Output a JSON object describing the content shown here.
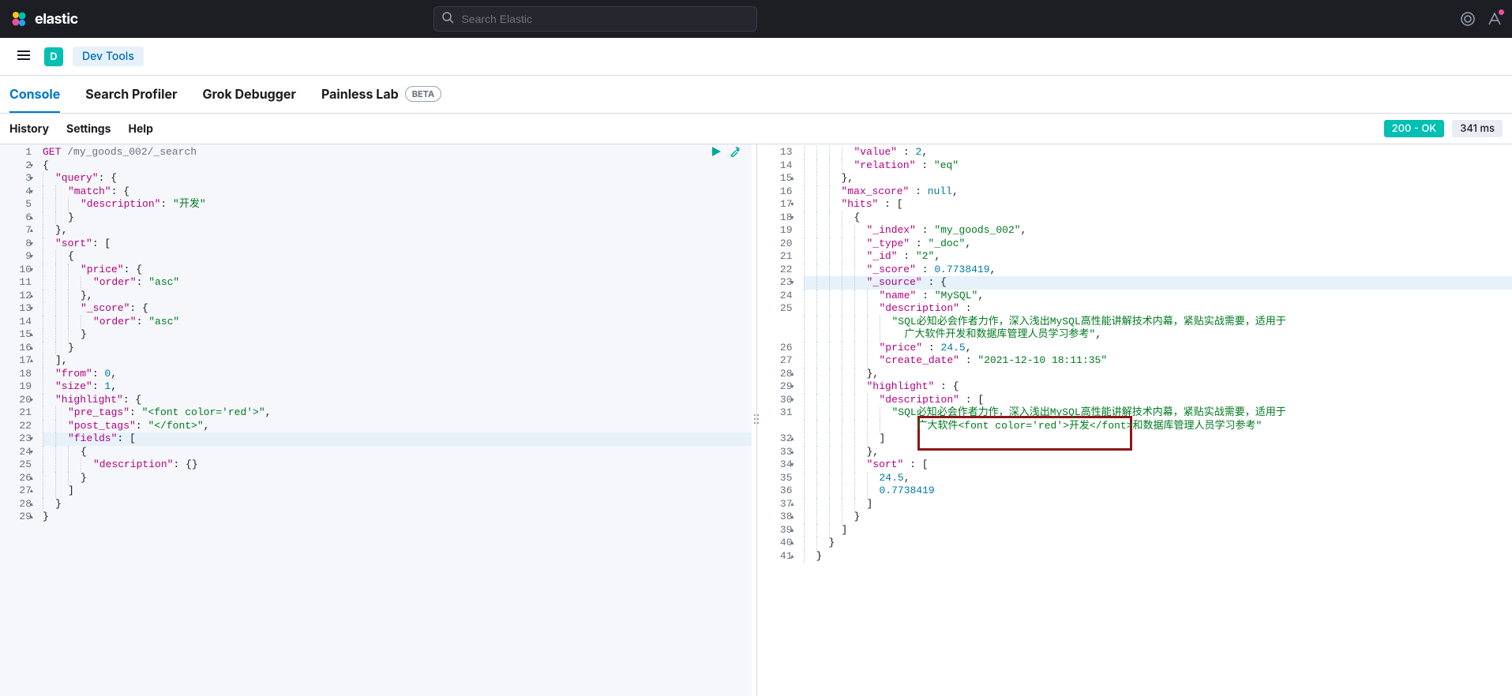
{
  "header": {
    "brand": "elastic",
    "search_placeholder": "Search Elastic"
  },
  "sub_header": {
    "app_badge": "D",
    "app_pill": "Dev Tools"
  },
  "tabs": [
    {
      "label": "Console",
      "active": true
    },
    {
      "label": "Search Profiler",
      "active": false
    },
    {
      "label": "Grok Debugger",
      "active": false
    },
    {
      "label": "Painless Lab",
      "active": false,
      "badge": "BETA"
    }
  ],
  "toolbar": {
    "items": [
      "History",
      "Settings",
      "Help"
    ],
    "status": "200 - OK",
    "timing": "341 ms"
  },
  "request": {
    "method": "GET",
    "path": "/my_goods_002/_search",
    "lines": [
      {
        "n": 1,
        "fold": "",
        "t": [
          {
            "c": "t-method",
            "v": "GET "
          },
          {
            "c": "t-path",
            "v": "/my_goods_002/_search"
          }
        ]
      },
      {
        "n": 2,
        "fold": "▾",
        "t": [
          {
            "c": "t-punc",
            "v": "{"
          }
        ]
      },
      {
        "n": 3,
        "fold": "▾",
        "i": 1,
        "t": [
          {
            "c": "t-key",
            "v": "\"query\""
          },
          {
            "c": "t-punc",
            "v": ": {"
          }
        ]
      },
      {
        "n": 4,
        "fold": "▾",
        "i": 2,
        "t": [
          {
            "c": "t-key",
            "v": "\"match\""
          },
          {
            "c": "t-punc",
            "v": ": {"
          }
        ]
      },
      {
        "n": 5,
        "i": 3,
        "t": [
          {
            "c": "t-key",
            "v": "\"description\""
          },
          {
            "c": "t-punc",
            "v": ": "
          },
          {
            "c": "t-str",
            "v": "\"开发\""
          }
        ]
      },
      {
        "n": 6,
        "fold": "▴",
        "i": 2,
        "t": [
          {
            "c": "t-punc",
            "v": "}"
          }
        ]
      },
      {
        "n": 7,
        "fold": "▴",
        "i": 1,
        "t": [
          {
            "c": "t-punc",
            "v": "},"
          }
        ]
      },
      {
        "n": 8,
        "fold": "▾",
        "i": 1,
        "t": [
          {
            "c": "t-key",
            "v": "\"sort\""
          },
          {
            "c": "t-punc",
            "v": ": ["
          }
        ]
      },
      {
        "n": 9,
        "fold": "▾",
        "i": 2,
        "t": [
          {
            "c": "t-punc",
            "v": "{"
          }
        ]
      },
      {
        "n": 10,
        "fold": "▾",
        "i": 3,
        "t": [
          {
            "c": "t-key",
            "v": "\"price\""
          },
          {
            "c": "t-punc",
            "v": ": {"
          }
        ]
      },
      {
        "n": 11,
        "i": 4,
        "t": [
          {
            "c": "t-key",
            "v": "\"order\""
          },
          {
            "c": "t-punc",
            "v": ": "
          },
          {
            "c": "t-str",
            "v": "\"asc\""
          }
        ]
      },
      {
        "n": 12,
        "fold": "▴",
        "i": 3,
        "t": [
          {
            "c": "t-punc",
            "v": "},"
          }
        ]
      },
      {
        "n": 13,
        "fold": "▾",
        "i": 3,
        "t": [
          {
            "c": "t-key",
            "v": "\"_score\""
          },
          {
            "c": "t-punc",
            "v": ": {"
          }
        ]
      },
      {
        "n": 14,
        "i": 4,
        "t": [
          {
            "c": "t-key",
            "v": "\"order\""
          },
          {
            "c": "t-punc",
            "v": ": "
          },
          {
            "c": "t-str",
            "v": "\"asc\""
          }
        ]
      },
      {
        "n": 15,
        "fold": "▴",
        "i": 3,
        "t": [
          {
            "c": "t-punc",
            "v": "}"
          }
        ]
      },
      {
        "n": 16,
        "fold": "▴",
        "i": 2,
        "t": [
          {
            "c": "t-punc",
            "v": "}"
          }
        ]
      },
      {
        "n": 17,
        "fold": "▴",
        "i": 1,
        "t": [
          {
            "c": "t-punc",
            "v": "],"
          }
        ]
      },
      {
        "n": 18,
        "i": 1,
        "t": [
          {
            "c": "t-key",
            "v": "\"from\""
          },
          {
            "c": "t-punc",
            "v": ": "
          },
          {
            "c": "t-num",
            "v": "0"
          },
          {
            "c": "t-punc",
            "v": ","
          }
        ]
      },
      {
        "n": 19,
        "i": 1,
        "t": [
          {
            "c": "t-key",
            "v": "\"size\""
          },
          {
            "c": "t-punc",
            "v": ": "
          },
          {
            "c": "t-num",
            "v": "1"
          },
          {
            "c": "t-punc",
            "v": ","
          }
        ]
      },
      {
        "n": 20,
        "fold": "▾",
        "i": 1,
        "t": [
          {
            "c": "t-key",
            "v": "\"highlight\""
          },
          {
            "c": "t-punc",
            "v": ": {"
          }
        ]
      },
      {
        "n": 21,
        "i": 2,
        "t": [
          {
            "c": "t-key",
            "v": "\"pre_tags\""
          },
          {
            "c": "t-punc",
            "v": ": "
          },
          {
            "c": "t-str",
            "v": "\"<font color='red'>\""
          },
          {
            "c": "t-punc",
            "v": ","
          }
        ]
      },
      {
        "n": 22,
        "i": 2,
        "t": [
          {
            "c": "t-key",
            "v": "\"post_tags\""
          },
          {
            "c": "t-punc",
            "v": ": "
          },
          {
            "c": "t-str",
            "v": "\"</font>\""
          },
          {
            "c": "t-punc",
            "v": ","
          }
        ]
      },
      {
        "n": 23,
        "fold": "▾",
        "i": 2,
        "hl": true,
        "t": [
          {
            "c": "t-key",
            "v": "\"fields\""
          },
          {
            "c": "t-punc",
            "v": ": ["
          }
        ]
      },
      {
        "n": 24,
        "fold": "▾",
        "i": 3,
        "t": [
          {
            "c": "t-punc",
            "v": "{"
          }
        ]
      },
      {
        "n": 25,
        "i": 4,
        "t": [
          {
            "c": "t-key",
            "v": "\"description\""
          },
          {
            "c": "t-punc",
            "v": ": {}"
          }
        ]
      },
      {
        "n": 26,
        "fold": "▴",
        "i": 3,
        "t": [
          {
            "c": "t-punc",
            "v": "}"
          }
        ]
      },
      {
        "n": 27,
        "fold": "▴",
        "i": 2,
        "t": [
          {
            "c": "t-punc",
            "v": "]"
          }
        ]
      },
      {
        "n": 28,
        "fold": "▴",
        "i": 1,
        "t": [
          {
            "c": "t-punc",
            "v": "}"
          }
        ]
      },
      {
        "n": 29,
        "fold": "▴",
        "t": [
          {
            "c": "t-punc",
            "v": "}"
          }
        ]
      }
    ]
  },
  "response": {
    "lines": [
      {
        "n": 13,
        "i": 4,
        "t": [
          {
            "c": "t-key",
            "v": "\"value\""
          },
          {
            "c": "t-punc",
            "v": " : "
          },
          {
            "c": "t-num",
            "v": "2"
          },
          {
            "c": "t-punc",
            "v": ","
          }
        ]
      },
      {
        "n": 14,
        "i": 4,
        "t": [
          {
            "c": "t-key",
            "v": "\"relation\""
          },
          {
            "c": "t-punc",
            "v": " : "
          },
          {
            "c": "t-str",
            "v": "\"eq\""
          }
        ]
      },
      {
        "n": 15,
        "fold": "▴",
        "i": 3,
        "t": [
          {
            "c": "t-punc",
            "v": "},"
          }
        ]
      },
      {
        "n": 16,
        "i": 3,
        "t": [
          {
            "c": "t-key",
            "v": "\"max_score\""
          },
          {
            "c": "t-punc",
            "v": " : "
          },
          {
            "c": "t-kw",
            "v": "null"
          },
          {
            "c": "t-punc",
            "v": ","
          }
        ]
      },
      {
        "n": 17,
        "fold": "▾",
        "i": 3,
        "t": [
          {
            "c": "t-key",
            "v": "\"hits\""
          },
          {
            "c": "t-punc",
            "v": " : ["
          }
        ]
      },
      {
        "n": 18,
        "fold": "▾",
        "i": 4,
        "t": [
          {
            "c": "t-punc",
            "v": "{"
          }
        ]
      },
      {
        "n": 19,
        "i": 5,
        "t": [
          {
            "c": "t-key",
            "v": "\"_index\""
          },
          {
            "c": "t-punc",
            "v": " : "
          },
          {
            "c": "t-str",
            "v": "\"my_goods_002\""
          },
          {
            "c": "t-punc",
            "v": ","
          }
        ]
      },
      {
        "n": 20,
        "i": 5,
        "t": [
          {
            "c": "t-key",
            "v": "\"_type\""
          },
          {
            "c": "t-punc",
            "v": " : "
          },
          {
            "c": "t-str",
            "v": "\"_doc\""
          },
          {
            "c": "t-punc",
            "v": ","
          }
        ]
      },
      {
        "n": 21,
        "i": 5,
        "t": [
          {
            "c": "t-key",
            "v": "\"_id\""
          },
          {
            "c": "t-punc",
            "v": " : "
          },
          {
            "c": "t-str",
            "v": "\"2\""
          },
          {
            "c": "t-punc",
            "v": ","
          }
        ]
      },
      {
        "n": 22,
        "i": 5,
        "t": [
          {
            "c": "t-key",
            "v": "\"_score\""
          },
          {
            "c": "t-punc",
            "v": " : "
          },
          {
            "c": "t-num",
            "v": "0.7738419"
          },
          {
            "c": "t-punc",
            "v": ","
          }
        ]
      },
      {
        "n": 23,
        "fold": "▾",
        "i": 5,
        "hl": true,
        "t": [
          {
            "c": "t-key",
            "v": "\"_source\""
          },
          {
            "c": "t-punc",
            "v": " : {"
          }
        ]
      },
      {
        "n": 24,
        "i": 6,
        "t": [
          {
            "c": "t-key",
            "v": "\"name\""
          },
          {
            "c": "t-punc",
            "v": " : "
          },
          {
            "c": "t-str",
            "v": "\"MySQL\""
          },
          {
            "c": "t-punc",
            "v": ","
          }
        ]
      },
      {
        "n": 25,
        "i": 6,
        "t": [
          {
            "c": "t-key",
            "v": "\"description\""
          },
          {
            "c": "t-punc",
            "v": " :"
          }
        ]
      },
      {
        "n": "25b",
        "i": 7,
        "t": [
          {
            "c": "t-str",
            "v": "\"SQL必知必会作者力作，深入浅出MySQL高性能讲解技术内幕，紧贴实战需要，适用于"
          }
        ]
      },
      {
        "n": "25c",
        "i": 7,
        "ex": 1,
        "t": [
          {
            "c": "t-str",
            "v": "广大软件开发和数据库管理人员学习参考\""
          },
          {
            "c": "t-punc",
            "v": ","
          }
        ]
      },
      {
        "n": 26,
        "i": 6,
        "t": [
          {
            "c": "t-key",
            "v": "\"price\""
          },
          {
            "c": "t-punc",
            "v": " : "
          },
          {
            "c": "t-num",
            "v": "24.5"
          },
          {
            "c": "t-punc",
            "v": ","
          }
        ]
      },
      {
        "n": 27,
        "i": 6,
        "t": [
          {
            "c": "t-key",
            "v": "\"create_date\""
          },
          {
            "c": "t-punc",
            "v": " : "
          },
          {
            "c": "t-str",
            "v": "\"2021-12-10 18:11:35\""
          }
        ]
      },
      {
        "n": 28,
        "fold": "▴",
        "i": 5,
        "t": [
          {
            "c": "t-punc",
            "v": "},"
          }
        ]
      },
      {
        "n": 29,
        "fold": "▾",
        "i": 5,
        "t": [
          {
            "c": "t-key",
            "v": "\"highlight\""
          },
          {
            "c": "t-punc",
            "v": " : {"
          }
        ]
      },
      {
        "n": 30,
        "fold": "▾",
        "i": 6,
        "t": [
          {
            "c": "t-key",
            "v": "\"description\""
          },
          {
            "c": "t-punc",
            "v": " : ["
          }
        ]
      },
      {
        "n": 31,
        "i": 7,
        "t": [
          {
            "c": "t-str",
            "v": "\"SQL必知必会作者力作，深入浅出MySQL高性能讲解技术内幕，紧贴实战需要，适用于"
          }
        ]
      },
      {
        "n": "31b",
        "i": 7,
        "ex": 2,
        "t": [
          {
            "c": "t-str",
            "v": "广大软件<font color='red'>开发</font>和数据库管理人员学习参考\""
          }
        ]
      },
      {
        "n": 32,
        "fold": "▴",
        "i": 6,
        "t": [
          {
            "c": "t-punc",
            "v": "]"
          }
        ]
      },
      {
        "n": 33,
        "fold": "▴",
        "i": 5,
        "t": [
          {
            "c": "t-punc",
            "v": "},"
          }
        ]
      },
      {
        "n": 34,
        "fold": "▾",
        "i": 5,
        "t": [
          {
            "c": "t-key",
            "v": "\"sort\""
          },
          {
            "c": "t-punc",
            "v": " : ["
          }
        ]
      },
      {
        "n": 35,
        "i": 6,
        "t": [
          {
            "c": "t-num",
            "v": "24.5"
          },
          {
            "c": "t-punc",
            "v": ","
          }
        ]
      },
      {
        "n": 36,
        "i": 6,
        "t": [
          {
            "c": "t-num",
            "v": "0.7738419"
          }
        ]
      },
      {
        "n": 37,
        "fold": "▴",
        "i": 5,
        "t": [
          {
            "c": "t-punc",
            "v": "]"
          }
        ]
      },
      {
        "n": 38,
        "fold": "▴",
        "i": 4,
        "t": [
          {
            "c": "t-punc",
            "v": "}"
          }
        ]
      },
      {
        "n": 39,
        "fold": "▴",
        "i": 3,
        "t": [
          {
            "c": "t-punc",
            "v": "]"
          }
        ]
      },
      {
        "n": 40,
        "fold": "▴",
        "i": 2,
        "t": [
          {
            "c": "t-punc",
            "v": "}"
          }
        ]
      },
      {
        "n": 41,
        "fold": "▴",
        "i": 1,
        "t": [
          {
            "c": "t-punc",
            "v": "}"
          }
        ]
      }
    ]
  }
}
